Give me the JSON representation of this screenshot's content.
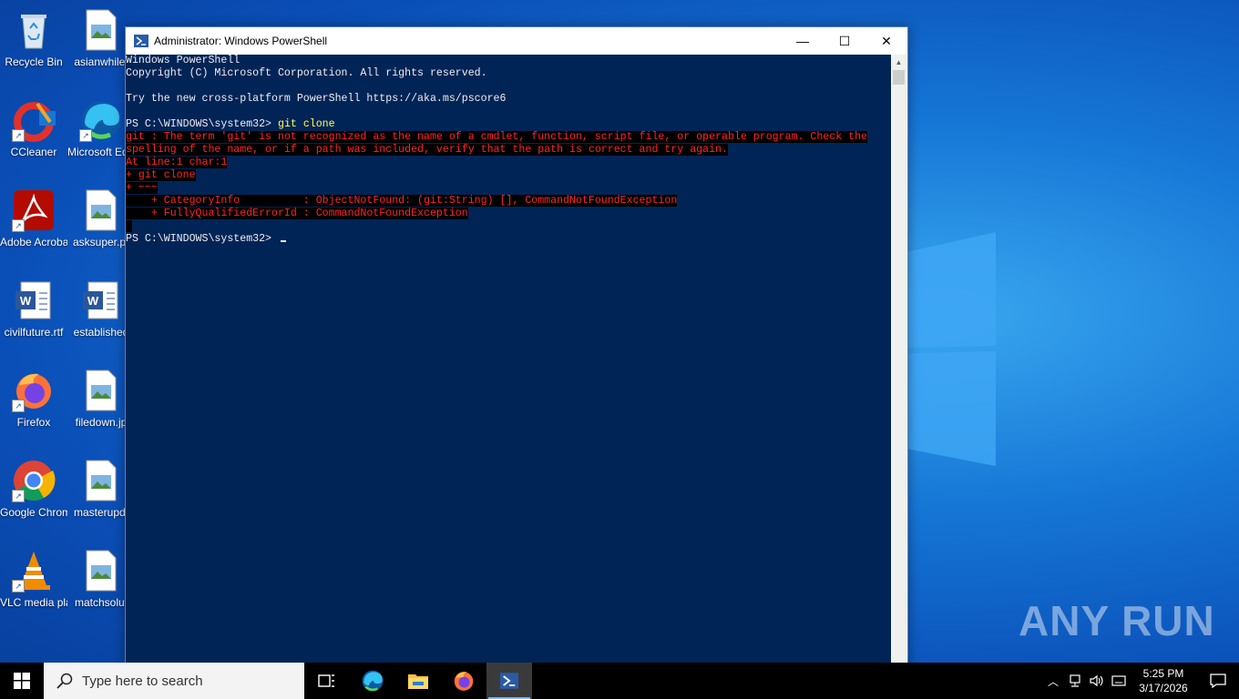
{
  "desktop": {
    "icons": [
      {
        "label": "Recycle Bin"
      },
      {
        "label": "asianwhile."
      },
      {
        "label": "CCleaner"
      },
      {
        "label": "Microsoft Edge"
      },
      {
        "label": "Adobe Acrobat"
      },
      {
        "label": "asksuper.pr"
      },
      {
        "label": "civilfuture.rtf"
      },
      {
        "label": "established"
      },
      {
        "label": "Firefox"
      },
      {
        "label": "filedown.jp"
      },
      {
        "label": "Google Chrome"
      },
      {
        "label": "masterupd."
      },
      {
        "label": "VLC media player"
      },
      {
        "label": "matchsolut"
      }
    ],
    "watermark": "ANY RUN"
  },
  "window": {
    "title": "Administrator: Windows PowerShell",
    "minimize": "—",
    "maximize": "☐",
    "close": "✕"
  },
  "console": {
    "lines": [
      {
        "text": "Windows PowerShell",
        "style": "normal"
      },
      {
        "text": "Copyright (C) Microsoft Corporation. All rights reserved.",
        "style": "normal"
      },
      {
        "text": "",
        "style": "normal"
      },
      {
        "text": "Try the new cross-platform PowerShell https://aka.ms/pscore6",
        "style": "normal"
      },
      {
        "text": "",
        "style": "normal"
      },
      {
        "text": "PS C:\\WINDOWS\\system32> ",
        "style": "prompt",
        "command": "git clone"
      },
      {
        "text": "git : The term 'git' is not recognized as the name of a cmdlet, function, script file, or operable program. Check the",
        "style": "error"
      },
      {
        "text": "spelling of the name, or if a path was included, verify that the path is correct and try again.",
        "style": "error"
      },
      {
        "text": "At line:1 char:1",
        "style": "error"
      },
      {
        "text": "+ git clone",
        "style": "error"
      },
      {
        "text": "+ ~~~",
        "style": "error"
      },
      {
        "text": "    + CategoryInfo          : ObjectNotFound: (git:String) [], CommandNotFoundException",
        "style": "error"
      },
      {
        "text": "    + FullyQualifiedErrorId : CommandNotFoundException",
        "style": "error"
      },
      {
        "text": " ",
        "style": "error"
      },
      {
        "text": "PS C:\\WINDOWS\\system32> ",
        "style": "prompt",
        "command": "",
        "cursor": true
      }
    ]
  },
  "taskbar": {
    "search_placeholder": "Type here to search",
    "time": "5:25 PM",
    "date": "3/17/2026"
  }
}
